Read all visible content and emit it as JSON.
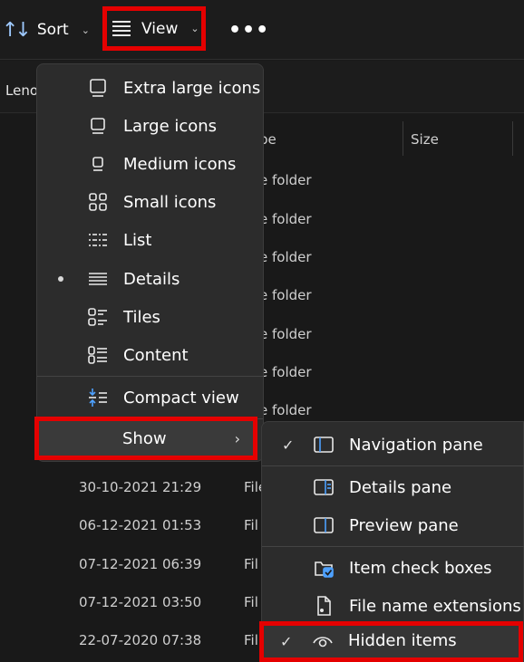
{
  "toolbar": {
    "sort_label": "Sort",
    "view_label": "View",
    "more_label": "•••"
  },
  "address": {
    "breadcrumb": "Leno"
  },
  "columns": {
    "type": "pe",
    "size": "Size"
  },
  "background_rows": {
    "types": [
      "e folder",
      "e folder",
      "e folder",
      "e folder",
      "e folder",
      "e folder",
      "e folder"
    ],
    "dates": [
      "30-10-2021 21:29",
      "06-12-2021 01:53",
      "07-12-2021 06:39",
      "07-12-2021 03:50",
      "22-07-2020 07:38"
    ],
    "kind_prefix": [
      "File",
      "Fil",
      "Fil",
      "Fil",
      "Fil"
    ]
  },
  "view_menu": {
    "items": [
      {
        "label": "Extra large icons",
        "icon": "extra-large-icons-icon"
      },
      {
        "label": "Large icons",
        "icon": "large-icons-icon"
      },
      {
        "label": "Medium icons",
        "icon": "medium-icons-icon"
      },
      {
        "label": "Small icons",
        "icon": "small-icons-icon"
      },
      {
        "label": "List",
        "icon": "list-icon"
      },
      {
        "label": "Details",
        "icon": "details-icon",
        "selected": true
      },
      {
        "label": "Tiles",
        "icon": "tiles-icon"
      },
      {
        "label": "Content",
        "icon": "content-icon"
      }
    ],
    "compact_label": "Compact view",
    "show_label": "Show"
  },
  "show_menu": {
    "items": [
      {
        "label": "Navigation pane",
        "checked": true
      },
      {
        "label": "Details pane",
        "checked": false
      },
      {
        "label": "Preview pane",
        "checked": false
      },
      {
        "label": "Item check boxes",
        "checked": false
      },
      {
        "label": "File name extensions",
        "checked": false
      },
      {
        "label": "Hidden items",
        "checked": true
      }
    ],
    "check_glyph": "✓"
  },
  "colors": {
    "highlight": "#e50000",
    "accent": "#4ea1ff",
    "menu_bg": "#2c2c2c"
  }
}
